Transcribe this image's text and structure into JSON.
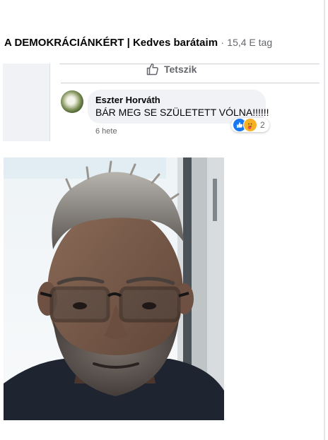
{
  "group": {
    "name": "A DEMOKRÁCIÁNKÉRT | Kedves barátaim",
    "separator": "·",
    "members": "15,4 E tag"
  },
  "post": {
    "like_label": "Tetszik"
  },
  "comment": {
    "author": "Eszter Horváth",
    "text": "BÁR MEG SE SZÜLETETT VÓLNA!!!!!!",
    "timestamp": "6 hete",
    "reaction_count": "2",
    "reactions": [
      "like-icon",
      "care-icon"
    ]
  },
  "colors": {
    "like_blue": "#1877f2",
    "secondary_text": "#65676b",
    "bubble_bg": "#f0f2f5"
  }
}
